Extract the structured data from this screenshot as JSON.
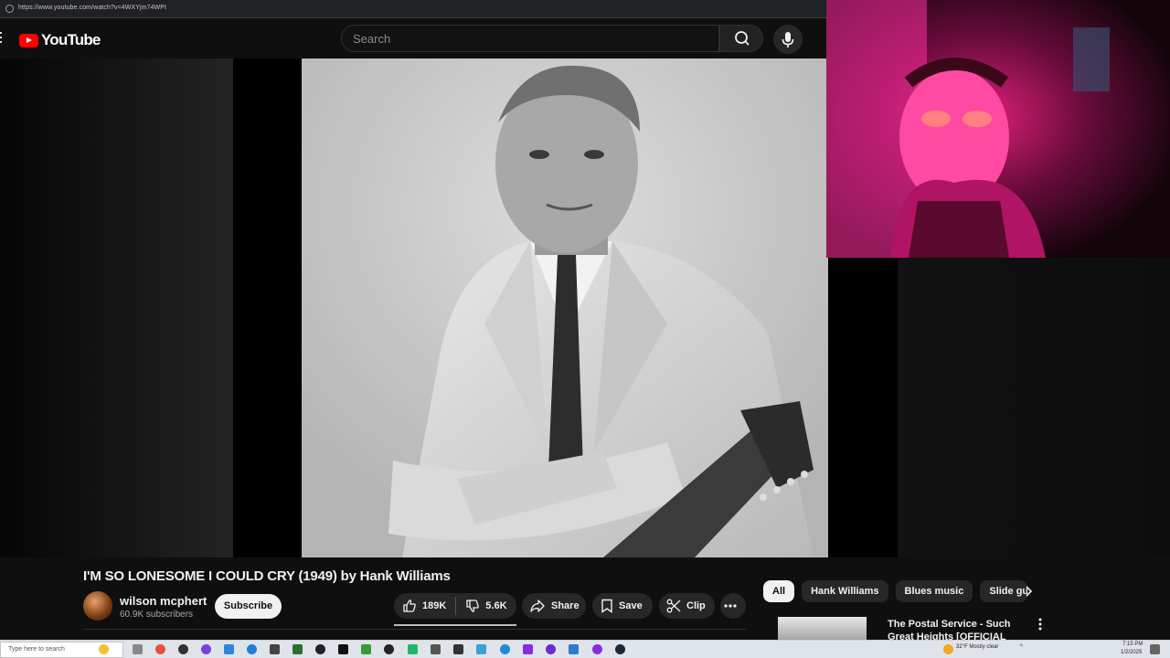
{
  "browser": {
    "url": "https://www.youtube.com/watch?v=4WXYjm74WPI"
  },
  "header": {
    "logo_text": "YouTube",
    "search_placeholder": "Search"
  },
  "video": {
    "title": "I'M SO LONESOME I COULD CRY (1949) by Hank Williams",
    "channel": {
      "name": "wilson mcphert",
      "subscribers": "60.9K subscribers"
    },
    "subscribe_label": "Subscribe",
    "likes": "189K",
    "dislikes": "5.6K",
    "share_label": "Share",
    "save_label": "Save",
    "clip_label": "Clip"
  },
  "chips": [
    "All",
    "Hank Williams",
    "Blues music",
    "Slide gui"
  ],
  "recommendation": {
    "title": "The Postal Service - Such Great Heights [OFFICIAL VIDEO]"
  },
  "taskbar": {
    "search_placeholder": "Type here to search",
    "weather": "32°F  Mostly clear",
    "time": "7:15 PM",
    "date": "1/2/2025"
  },
  "colors": {
    "brand_red": "#ff0000",
    "background": "#0f0f0f",
    "pill": "#272727"
  }
}
